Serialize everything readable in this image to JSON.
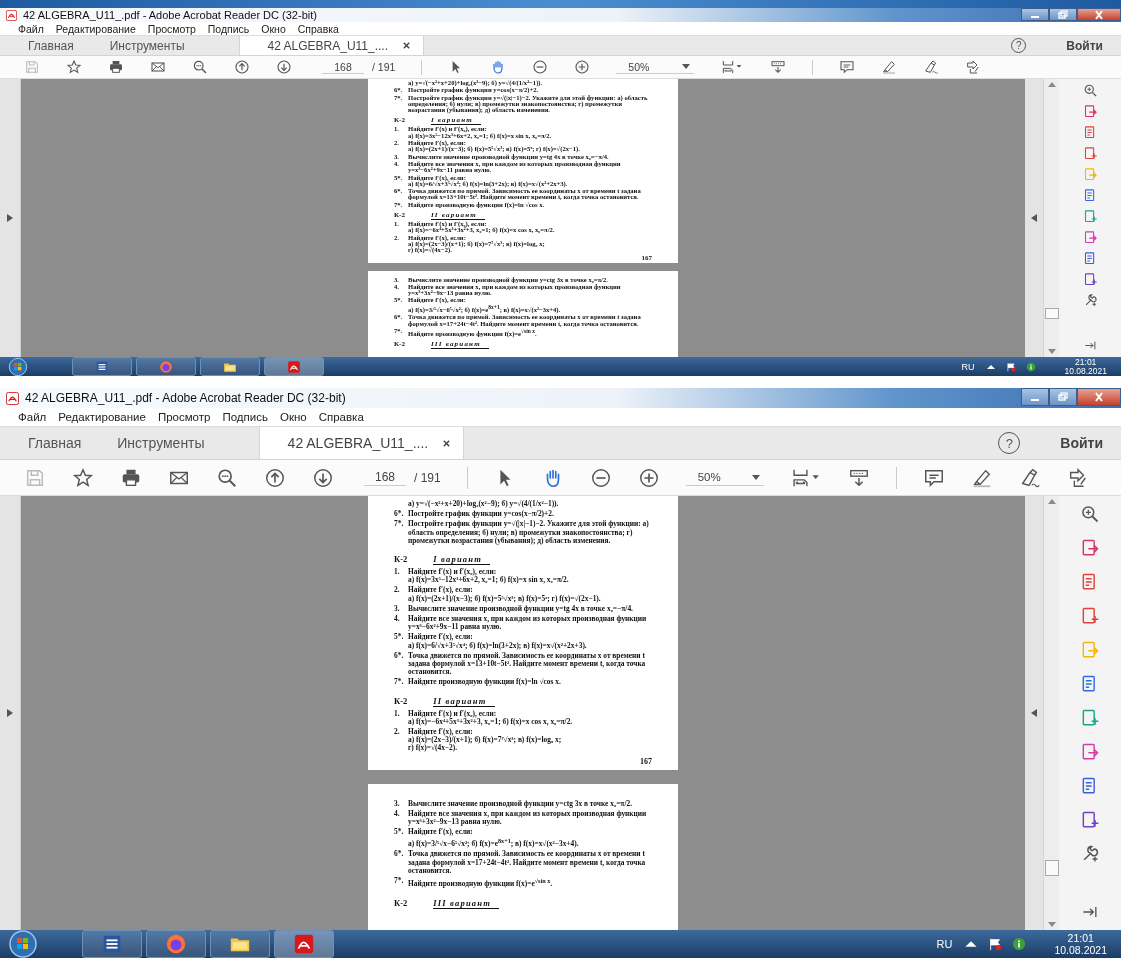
{
  "screens": [
    {
      "window": {
        "title": "42 ALGEBRA_U11_.pdf - Adobe Acrobat Reader DC (32-bit)"
      },
      "menu": [
        "Файл",
        "Редактирование",
        "Просмотр",
        "Подпись",
        "Окно",
        "Справка"
      ],
      "tabs": [
        {
          "label": "Главная",
          "selected": false
        },
        {
          "label": "Инструменты",
          "selected": false
        },
        {
          "label": "42 ALGEBRA_U11_....",
          "selected": true
        }
      ],
      "help": "?",
      "sign_in": "Войти",
      "toolbar": {
        "save_disabled": true,
        "page": "168",
        "page_total": "/ 191",
        "hand_selected": true,
        "zoom": "50%"
      },
      "document": {
        "pages": [
          {
            "blocks": [
              {
                "kind": "line",
                "text": "а) y=√(−x²+x+20)+log₂(x²−9);      б) y=√(4/(1/x²−1))."
              },
              {
                "kind": "item",
                "number": "6*.",
                "text": "Постройте график функции y=cos(x−π/2)+2."
              },
              {
                "kind": "item",
                "number": "7*.",
                "text": "Постройте график функции y=√(|x|−1)−2. Укажите для этой функции: а) область определения; б) нули; в) промежутки знакопостоянства; г) промежутки возрастания (убывания); д) область изменения."
              },
              {
                "kind": "heading",
                "code": "К-2",
                "variant": "I вариант"
              },
              {
                "kind": "item",
                "number": "1.",
                "text": "Найдите f′(x) и f′(x₀), если:",
                "sub": [
                  "а) f(x)=3x⁵−12x³+6x+2, x₀=1; б) f(x)=x sin x, x₀=π/2."
                ]
              },
              {
                "kind": "item",
                "number": "2.",
                "text": "Найдите f′(x), если:",
                "sub": [
                  "а) f(x)=(2x+1)/(x−3); б) f(x)=5⁵√x³; в) f(x)=5ˣ; г) f(x)=√(2x−1)."
                ]
              },
              {
                "kind": "item",
                "number": "3.",
                "text": "Вычислите значение производной функции y=tg 4x в точке x₀=−π/4."
              },
              {
                "kind": "item",
                "number": "4.",
                "text": "Найдите все значения x, при каждом из которых производная функции y=x³−6x²+9x−11 равна нулю."
              },
              {
                "kind": "item",
                "number": "5*.",
                "text": "Найдите f′(x), если:",
                "sub": [
                  "а) f(x)=6/√x+3⁵√x⁴; б) f(x)=ln(3+2x); в) f(x)=x√(x²+2x+3)."
                ]
              },
              {
                "kind": "item",
                "number": "6*.",
                "text": "Точка движется по прямой. Зависимость ее координаты x от времени t задана формулой x=13+10t−5t². Найдите момент времени t, когда точка остановится."
              },
              {
                "kind": "item",
                "number": "7*.",
                "text": "Найдите производную функции f(x)=ln √cos x."
              },
              {
                "kind": "heading",
                "code": "К-2",
                "variant": "II вариант"
              },
              {
                "kind": "item",
                "number": "1.",
                "text": "Найдите f′(x) и f′(x₀), если:",
                "sub": [
                  "а) f(x)=−6x⁴+5x³+3x²+3, x₀=1; б) f(x)=x cos x, x₀=π/2."
                ]
              },
              {
                "kind": "item",
                "number": "2.",
                "text": "Найдите f′(x), если:",
                "sub": [
                  "а) f(x)=(2x−3)/(x+1); б) f(x)=7⁷√x³; в) f(x)=log₅ x;",
                  "г) f(x)=√(4x−2)."
                ]
              }
            ],
            "page_number": "167"
          },
          {
            "blocks": [
              {
                "kind": "item",
                "number": "3.",
                "text": "Вычислите значение производной функции y=ctg 3x в точке x₀=π/2."
              },
              {
                "kind": "item",
                "number": "4.",
                "text": "Найдите все значения x, при каждом из которых производная функции y=x³+3x²−9x−13 равна нулю."
              },
              {
                "kind": "item",
                "number": "5*.",
                "text": "Найдите f′(x), если:",
                "sub": [
                  "а) f(x)=3/⁵√x−6⁵√x²; б) f(x)=e$^{8x+1}$; в) f(x)=x√(x²−3x+4)."
                ]
              },
              {
                "kind": "item",
                "number": "6*.",
                "text": "Точка движется по прямой. Зависимость ее координаты x от времени t задана формулой x=17+24t−4t². Найдите момент времени t, когда точка остановится."
              },
              {
                "kind": "item",
                "number": "7*.",
                "text": "Найдите производную функции f(x)=e$^{√sin x}$."
              },
              {
                "kind": "heading",
                "code": "К-2",
                "variant": "III вариант"
              }
            ]
          }
        ]
      },
      "taskbar": {
        "language": "RU",
        "time": "21:01",
        "date": "10.08.2021"
      }
    },
    {
      "window": {
        "title": "42 ALGEBRA_U11_.pdf - Adobe Acrobat Reader DC (32-bit)"
      },
      "menu": [
        "Файл",
        "Редактирование",
        "Просмотр",
        "Подпись",
        "Окно",
        "Справка"
      ],
      "tabs": [
        {
          "label": "Главная",
          "selected": false
        },
        {
          "label": "Инструменты",
          "selected": false
        },
        {
          "label": "42 ALGEBRA_U11_....",
          "selected": true
        }
      ],
      "help": "?",
      "sign_in": "Войти",
      "toolbar": {
        "save_disabled": true,
        "page": "168",
        "page_total": "/ 191",
        "hand_selected": true,
        "zoom": "50%"
      },
      "document": {
        "pages": [
          {
            "blocks": [
              {
                "kind": "line",
                "text": "а) y=√(−x²+x+20)+log₂(x²−9);      б) y=√(4/(1/x²−1))."
              },
              {
                "kind": "item",
                "number": "6*.",
                "text": "Постройте график функции y=cos(x−π/2)+2."
              },
              {
                "kind": "item",
                "number": "7*.",
                "text": "Постройте график функции y=√(|x|−1)−2. Укажите для этой функции: а) область определения; б) нули; в) промежутки знакопостоянства; г) промежутки возрастания (убывания); д) область изменения."
              },
              {
                "kind": "heading",
                "code": "К-2",
                "variant": "I вариант"
              },
              {
                "kind": "item",
                "number": "1.",
                "text": "Найдите f′(x) и f′(x₀), если:",
                "sub": [
                  "а) f(x)=3x⁵−12x³+6x+2, x₀=1; б) f(x)=x sin x, x₀=π/2."
                ]
              },
              {
                "kind": "item",
                "number": "2.",
                "text": "Найдите f′(x), если:",
                "sub": [
                  "а) f(x)=(2x+1)/(x−3); б) f(x)=5⁵√x³; в) f(x)=5ˣ; г) f(x)=√(2x−1)."
                ]
              },
              {
                "kind": "item",
                "number": "3.",
                "text": "Вычислите значение производной функции y=tg 4x в точке x₀=−π/4."
              },
              {
                "kind": "item",
                "number": "4.",
                "text": "Найдите все значения x, при каждом из которых производная функции y=x³−6x²+9x−11 равна нулю."
              },
              {
                "kind": "item",
                "number": "5*.",
                "text": "Найдите f′(x), если:",
                "sub": [
                  "а) f(x)=6/√x+3⁵√x⁴; б) f(x)=ln(3+2x); в) f(x)=x√(x²+2x+3)."
                ]
              },
              {
                "kind": "item",
                "number": "6*.",
                "text": "Точка движется по прямой. Зависимость ее координаты x от времени t задана формулой x=13+10t−5t². Найдите момент времени t, когда точка остановится."
              },
              {
                "kind": "item",
                "number": "7*.",
                "text": "Найдите производную функции f(x)=ln √cos x."
              },
              {
                "kind": "heading",
                "code": "К-2",
                "variant": "II вариант"
              },
              {
                "kind": "item",
                "number": "1.",
                "text": "Найдите f′(x) и f′(x₀), если:",
                "sub": [
                  "а) f(x)=−6x⁴+5x³+3x²+3, x₀=1; б) f(x)=x cos x, x₀=π/2."
                ]
              },
              {
                "kind": "item",
                "number": "2.",
                "text": "Найдите f′(x), если:",
                "sub": [
                  "а) f(x)=(2x−3)/(x+1); б) f(x)=7⁷√x³; в) f(x)=log₅ x;",
                  "г) f(x)=√(4x−2)."
                ]
              }
            ],
            "page_number": "167"
          },
          {
            "blocks": [
              {
                "kind": "item",
                "number": "3.",
                "text": "Вычислите значение производной функции y=ctg 3x в точке x₀=π/2."
              },
              {
                "kind": "item",
                "number": "4.",
                "text": "Найдите все значения x, при каждом из которых производная функции y=x³+3x²−9x−13 равна нулю."
              },
              {
                "kind": "item",
                "number": "5*.",
                "text": "Найдите f′(x), если:",
                "sub": [
                  "а) f(x)=3/⁵√x−6⁵√x²; б) f(x)=e$^{8x+1}$; в) f(x)=x√(x²−3x+4)."
                ]
              },
              {
                "kind": "item",
                "number": "6*.",
                "text": "Точка движется по прямой. Зависимость ее координаты x от времени t задана формулой x=17+24t−4t². Найдите момент времени t, когда точка остановится."
              },
              {
                "kind": "item",
                "number": "7*.",
                "text": "Найдите производную функции f(x)=e$^{√sin x}$."
              },
              {
                "kind": "heading",
                "code": "К-2",
                "variant": "III вариант"
              }
            ]
          }
        ]
      },
      "taskbar": {
        "language": "RU",
        "time": "21:01",
        "date": "10.08.2021"
      }
    }
  ]
}
